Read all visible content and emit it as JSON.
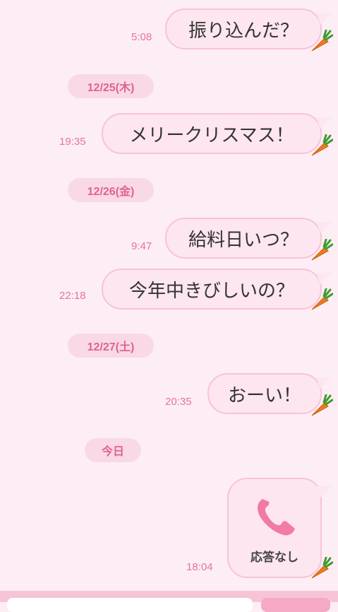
{
  "messages": [
    {
      "text": "振り込んだ？",
      "time": "5:08"
    },
    {
      "date": "12/25(木)"
    },
    {
      "text": "メリークリスマス！",
      "time": "19:35"
    },
    {
      "date": "12/26(金)"
    },
    {
      "text": "給料日いつ？",
      "time": "9:47"
    },
    {
      "text": "今年中きびしいの？",
      "time": "22:18"
    },
    {
      "date": "12/27(土)"
    },
    {
      "text": "おーい！",
      "time": "20:35"
    },
    {
      "date": "今日"
    },
    {
      "call_status": "応答なし",
      "time": "18:04",
      "icon": "phone-icon"
    }
  ],
  "colors": {
    "background": "#fdeef5",
    "bubble": "#fde6ef",
    "bubble_border": "#f7c3d6",
    "accent": "#e0628f",
    "phone": "#f17aa6"
  }
}
